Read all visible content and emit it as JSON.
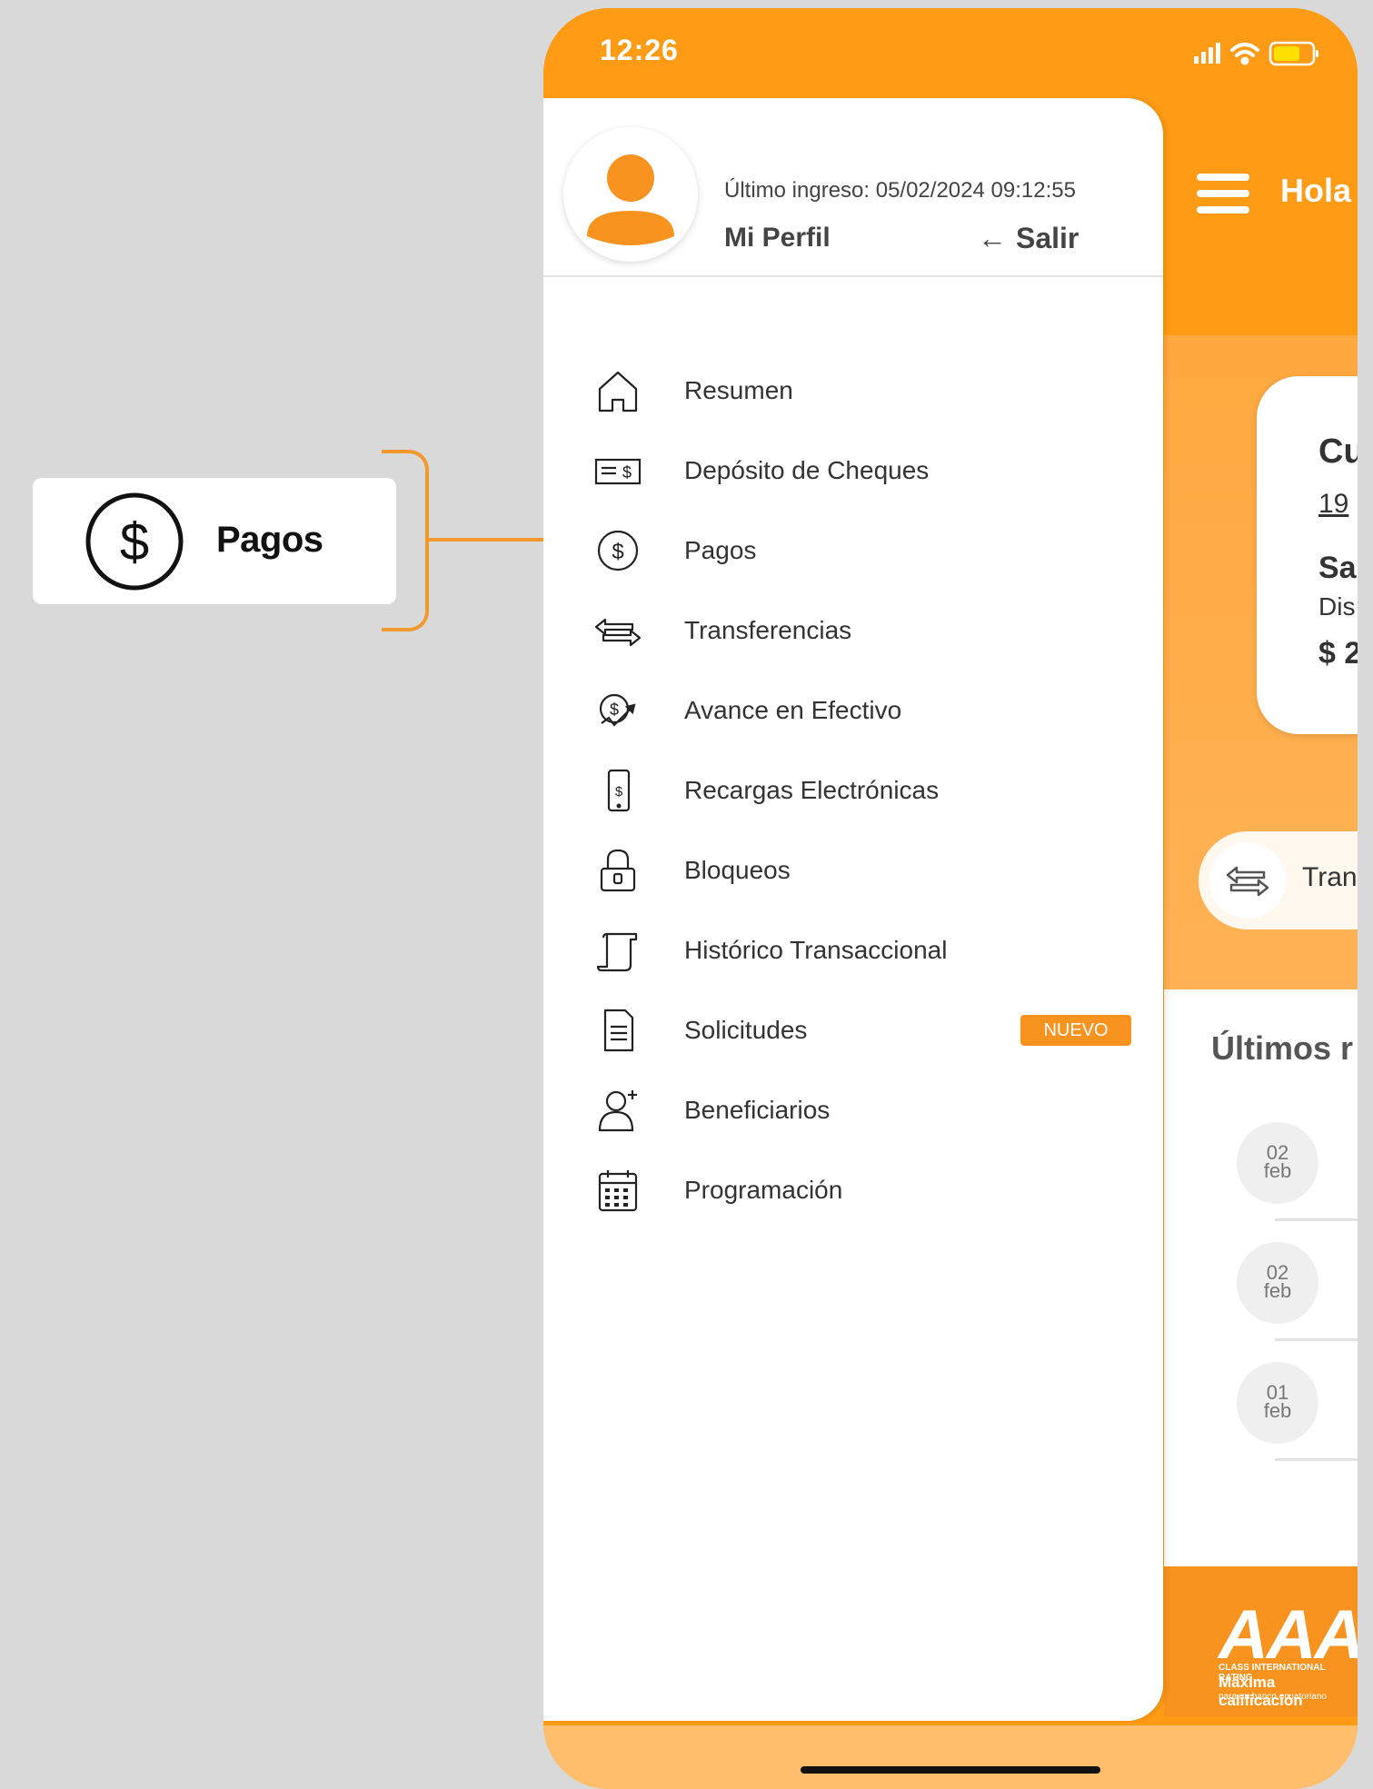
{
  "callout": {
    "label": "Pagos"
  },
  "status_bar": {
    "time": "12:26"
  },
  "drawer": {
    "last_login": "Último ingreso: 05/02/2024 09:12:55",
    "profile_label": "Mi Perfil",
    "logout_label": "Salir",
    "items": [
      {
        "label": "Resumen",
        "icon": "home-icon"
      },
      {
        "label": "Depósito  de Cheques",
        "icon": "check-deposit-icon"
      },
      {
        "label": "Pagos",
        "icon": "dollar-circle-icon"
      },
      {
        "label": "Transferencias",
        "icon": "transfer-arrows-icon"
      },
      {
        "label": "Avance en Efectivo",
        "icon": "cash-advance-icon"
      },
      {
        "label": "Recargas Electrónicas",
        "icon": "phone-recharge-icon"
      },
      {
        "label": "Bloqueos",
        "icon": "lock-icon"
      },
      {
        "label": "Histórico Transaccional",
        "icon": "scroll-icon"
      },
      {
        "label": "Solicitudes",
        "icon": "document-icon",
        "badge": "NUEVO"
      },
      {
        "label": "Beneficiarios",
        "icon": "add-user-icon"
      },
      {
        "label": "Programación",
        "icon": "calendar-icon"
      }
    ]
  },
  "background": {
    "greeting": "Hola",
    "card": {
      "line1": "Cu",
      "line2": "19",
      "line3": "Sa",
      "line4": "Dis",
      "line5": "$ 2"
    },
    "quick_action": "Tran",
    "movements_title": "Últimos r",
    "movements": [
      {
        "day": "02",
        "month": "feb"
      },
      {
        "day": "02",
        "month": "feb"
      },
      {
        "day": "01",
        "month": "feb"
      }
    ],
    "rating": {
      "badge": "AAA",
      "line1": "CLASS INTERNATIONAL RATING",
      "line2": "Máxima calificación",
      "line3": "para un banco ecuatoriano"
    }
  },
  "colors": {
    "accent": "#ff9b14",
    "badge": "#f7931e",
    "callout_line": "#f2992e"
  }
}
